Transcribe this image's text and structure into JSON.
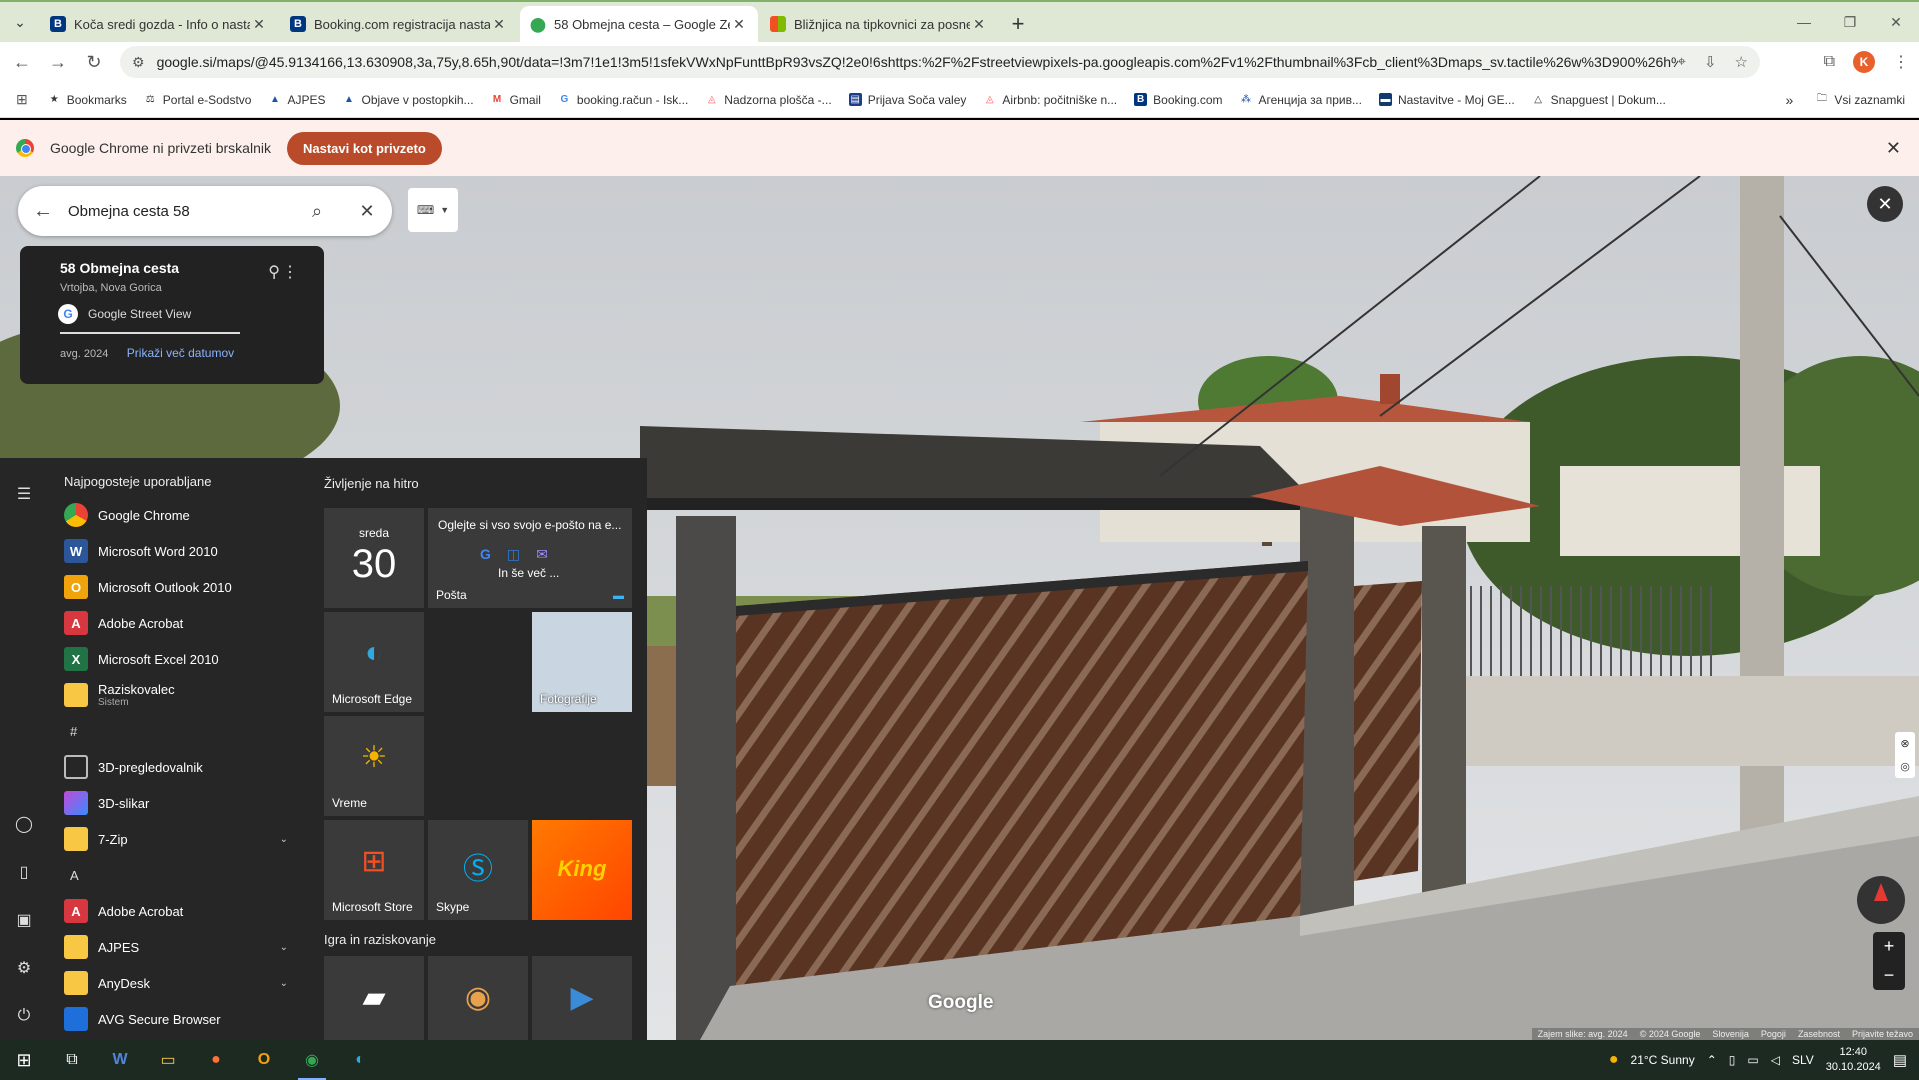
{
  "browser": {
    "tabs": [
      {
        "title": "Koča sredi gozda - Info o nasta",
        "icon": "booking-icon",
        "color": "#003580",
        "active": false
      },
      {
        "title": "Booking.com registracija nasta",
        "icon": "booking-icon",
        "color": "#003580",
        "active": false
      },
      {
        "title": "58 Obmejna cesta – Google Ze",
        "icon": "maps-pin-icon",
        "color": "#34a853",
        "active": true
      },
      {
        "title": "Bližnjica na tipkovnici za posne",
        "icon": "microsoft-icon",
        "color": "#f25022",
        "active": false
      }
    ],
    "url": "google.si/maps/@45.9134166,13.630908,3a,75y,8.65h,90t/data=!3m7!1e1!3m5!1sfekVWxNpFunttBpR93vsZQ!2e0!6shttps:%2F%2Fstreetviewpixels-pa.googleapis.com%2Fv1%2Fthumbnail%3Fcb_client%3Dmaps_sv.tactile%26w%3D900%26h%3D...",
    "profile_initial": "K",
    "bookmarks": [
      {
        "label": "Bookmarks",
        "icon": "star-icon"
      },
      {
        "label": "Portal e-Sodstvo",
        "icon": "scales-icon"
      },
      {
        "label": "AJPES",
        "icon": "ajpes-icon"
      },
      {
        "label": "Objave v postopkih...",
        "icon": "ajpes-icon"
      },
      {
        "label": "Gmail",
        "icon": "gmail-icon"
      },
      {
        "label": "booking.račun - Isk...",
        "icon": "google-icon"
      },
      {
        "label": "Nadzorna plošča -...",
        "icon": "airbnb-icon"
      },
      {
        "label": "Prijava Soča valey",
        "icon": "form-icon"
      },
      {
        "label": "Airbnb: počitniške n...",
        "icon": "airbnb-icon"
      },
      {
        "label": "Booking.com",
        "icon": "booking-icon"
      },
      {
        "label": "Агенција за прив...",
        "icon": "agency-icon"
      },
      {
        "label": "Nastavitve - Moj GE...",
        "icon": "ge-icon"
      },
      {
        "label": "Snapguest | Dokum...",
        "icon": "snapguest-icon"
      }
    ],
    "all_bookmarks_label": "Vsi zaznamki",
    "infobar_text": "Google Chrome ni privzeti brskalnik",
    "infobar_button": "Nastavi kot privzeto"
  },
  "maps": {
    "search_value": "Obmejna cesta 58",
    "card_title": "58 Obmejna cesta",
    "card_subtitle": "Vrtojba, Nova Gorica",
    "card_source": "Google Street View",
    "card_date": "avg. 2024",
    "card_more_dates": "Prikaži več datumov",
    "watermark": "Google",
    "attribution": [
      "Zajem slike: avg. 2024",
      "© 2024 Google",
      "Slovenija",
      "Pogoji",
      "Zasebnost",
      "Prijavite težavo"
    ]
  },
  "startmenu": {
    "most_used_title": "Najpogosteje uporabljane",
    "apps": [
      {
        "name": "Google Chrome",
        "icon": "chrome-icon",
        "color": "#4285f4"
      },
      {
        "name": "Microsoft Word 2010",
        "icon": "word-icon",
        "color": "#2b579a"
      },
      {
        "name": "Microsoft Outlook 2010",
        "icon": "outlook-icon",
        "color": "#f0a30a"
      },
      {
        "name": "Adobe Acrobat",
        "icon": "acrobat-icon",
        "color": "#d7373f"
      },
      {
        "name": "Microsoft Excel 2010",
        "icon": "excel-icon",
        "color": "#217346"
      },
      {
        "name": "Raziskovalec",
        "sub": "Sistem",
        "icon": "folder-icon",
        "color": "#f8c845"
      }
    ],
    "hash_label": "#",
    "hash_apps": [
      {
        "name": "3D-pregledovalnik",
        "icon": "cube-icon",
        "color": "#888"
      },
      {
        "name": "3D-slikar",
        "icon": "paint3d-icon",
        "color": "#c04ad8"
      },
      {
        "name": "7-Zip",
        "icon": "folder-icon",
        "color": "#f8c845",
        "expandable": true
      }
    ],
    "a_label": "A",
    "a_apps": [
      {
        "name": "Adobe Acrobat",
        "icon": "acrobat-icon",
        "color": "#d7373f"
      },
      {
        "name": "AJPES",
        "icon": "folder-icon",
        "color": "#f8c845",
        "expandable": true
      },
      {
        "name": "AnyDesk",
        "icon": "folder-icon",
        "color": "#f8c845",
        "expandable": true
      },
      {
        "name": "AVG Secure Browser",
        "icon": "avg-icon",
        "color": "#1e6fd9"
      }
    ],
    "life_title": "Življenje na hitro",
    "calendar_day": "sreda",
    "calendar_num": "30",
    "mail_heading": "Oglejte si vso svojo e-pošto na e...",
    "mail_more": "In še več ...",
    "mail_label": "Pošta",
    "edge_label": "Microsoft Edge",
    "photos_label": "Fotografije",
    "weather_label": "Vreme",
    "store_label": "Microsoft Store",
    "skype_label": "Skype",
    "king_label": "King",
    "play_title": "Igra in raziskovanje"
  },
  "taskbar": {
    "weather": "21°C  Sunny",
    "lang": "SLV",
    "time": "12:40",
    "date": "30.10.2024"
  }
}
